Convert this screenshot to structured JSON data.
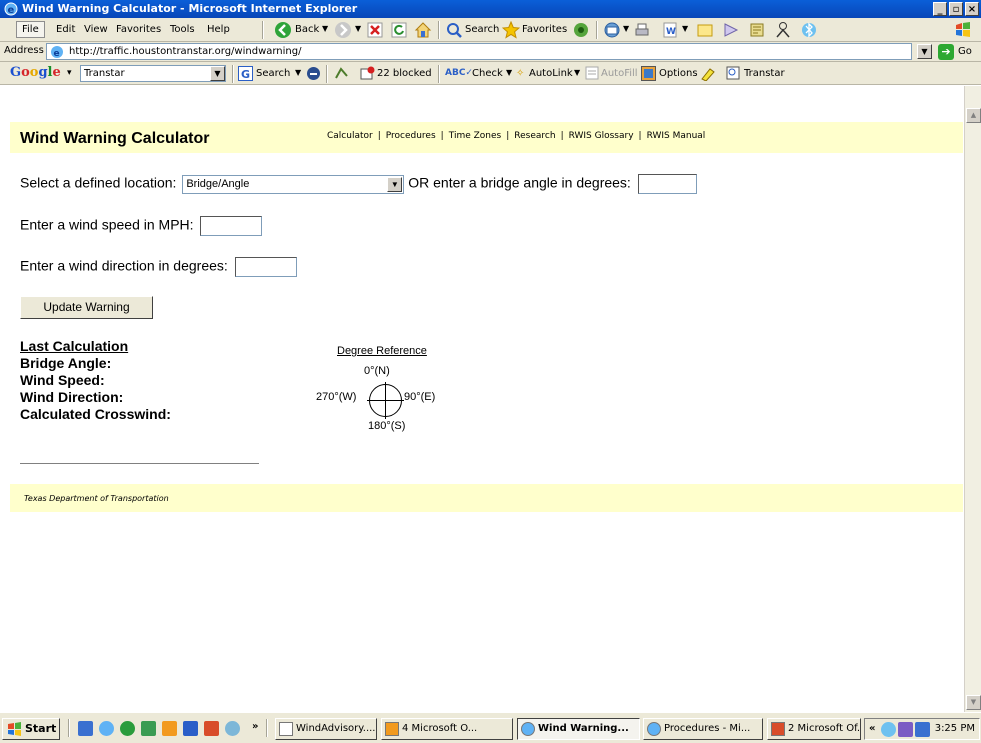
{
  "window": {
    "title": "Wind Warning Calculator - Microsoft Internet Explorer",
    "controls": [
      "_",
      "▫",
      "×"
    ]
  },
  "menubar": {
    "items": [
      "File",
      "Edit",
      "View",
      "Favorites",
      "Tools",
      "Help"
    ],
    "back_label": "Back",
    "search_label": "Search",
    "favorites_label": "Favorites"
  },
  "addressbar": {
    "label": "Address",
    "url": "http://traffic.houstontranstar.org/windwarning/",
    "go_label": "Go"
  },
  "googlebar": {
    "logo": "Google",
    "search_value": "Transtar",
    "search_label": "Search",
    "blocked_label": "22 blocked",
    "check_label": "Check",
    "autolink_label": "AutoLink",
    "autofill_label": "AutoFill",
    "options_label": "Options",
    "transtar_label": "Transtar"
  },
  "page": {
    "title": "Wind Warning Calculator",
    "nav": [
      "Calculator",
      "Procedures",
      "Time Zones",
      "Research",
      "RWIS Glossary",
      "RWIS Manual"
    ],
    "location_label": "Select a defined location:",
    "location_selected": "Bridge/Angle",
    "angle_label": "OR enter a bridge angle in degrees:",
    "angle_value": "",
    "speed_label": "Enter a wind speed in MPH:",
    "speed_value": "",
    "direction_label": "Enter a wind direction in degrees:",
    "direction_value": "",
    "update_button": "Update Warning",
    "results": {
      "heading": "Last Calculation",
      "bridge_angle": "Bridge Angle:",
      "wind_speed": "Wind Speed:",
      "wind_direction": "Wind Direction:",
      "crosswind": "Calculated Crosswind:"
    },
    "reference": {
      "title": "Degree Reference",
      "north": "0°(N)",
      "west": "270°(W)",
      "east": "90°(E)",
      "south": "180°(S)"
    },
    "footer": "Texas Department of Transportation"
  },
  "taskbar": {
    "start_label": "Start",
    "more_label": "»",
    "tasks": [
      "WindAdvisory....",
      "4 Microsoft O...",
      "Wind Warning...",
      "Procedures - Mi...",
      "2 Microsoft Of..."
    ],
    "tray_chevron": "«",
    "clock": "3:25 PM"
  }
}
